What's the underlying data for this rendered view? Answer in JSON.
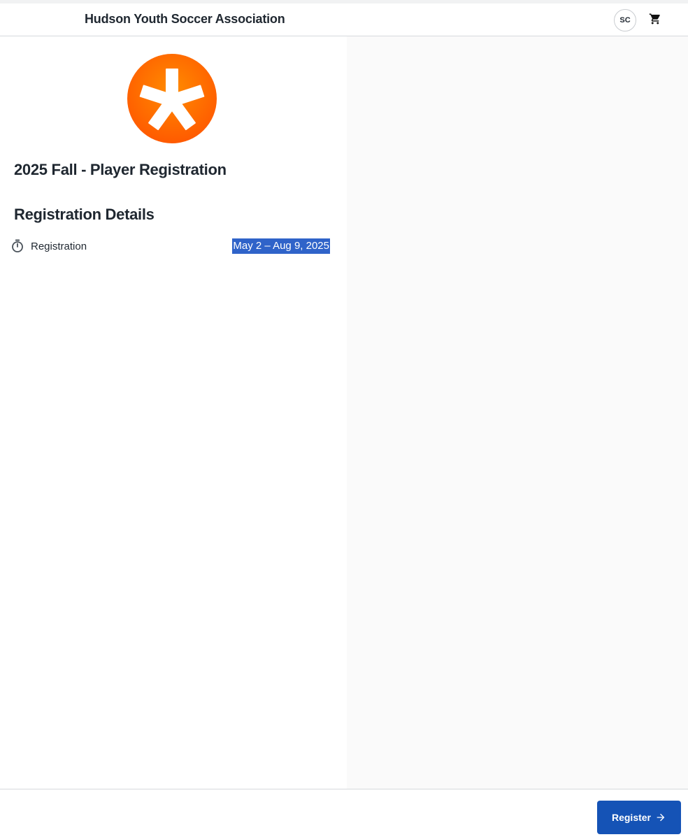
{
  "header": {
    "org_name": "Hudson Youth Soccer Association",
    "avatar_initials": "SC",
    "cart_icon": "cart-icon"
  },
  "logo": {
    "icon": "asterisk-logo",
    "color": "#ff6a00"
  },
  "event": {
    "title": "2025 Fall - Player Registration"
  },
  "details": {
    "heading": "Registration Details",
    "items": [
      {
        "icon": "timer-icon",
        "label": "Registration",
        "value": "May 2 – Aug 9, 2025"
      }
    ]
  },
  "footer": {
    "register_label": "Register",
    "register_icon": "arrow-right-icon",
    "accent": "#1553b6"
  }
}
